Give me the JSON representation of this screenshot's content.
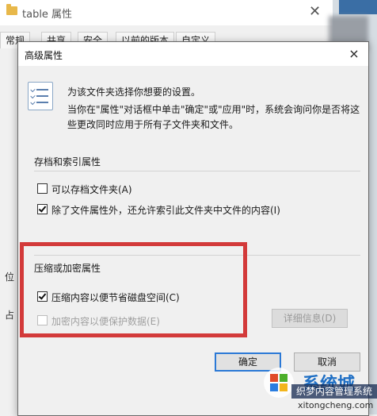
{
  "background_window": {
    "title": "table 属性",
    "tabs": [
      "常规",
      "共享",
      "安全",
      "以前的版本",
      "自定义"
    ],
    "fragments": [
      "位",
      "占"
    ]
  },
  "dialog": {
    "title": "高级属性",
    "close_symbol": "×",
    "intro": "为该文件夹选择你想要的设置。",
    "description": "当你在\"属性\"对话框中单击\"确定\"或\"应用\"时，系统会询问你是否将这些更改同时应用于所有子文件夹和文件。",
    "archive_group": {
      "label": "存档和索引属性",
      "options": [
        {
          "label": "可以存档文件夹(A)",
          "checked": false,
          "enabled": true
        },
        {
          "label": "除了文件属性外，还允许索引此文件夹中文件的内容(I)",
          "checked": true,
          "enabled": true
        }
      ]
    },
    "compress_group": {
      "label": "压缩或加密属性",
      "options": [
        {
          "label": "压缩内容以便节省磁盘空间(C)",
          "checked": true,
          "enabled": true
        },
        {
          "label": "加密内容以便保护数据(E)",
          "checked": false,
          "enabled": false
        }
      ],
      "details_button": "详细信息(D)"
    },
    "ok_button": "确定",
    "cancel_button": "取消"
  },
  "watermark": {
    "brand": "系统城",
    "banner": "织梦内容管理系统",
    "url": "xitongcheng.com"
  },
  "colors": {
    "highlight_border": "#d33a3a",
    "ok_button_focus": "#2b79d6",
    "disabled_text": "#a0a0a0"
  }
}
